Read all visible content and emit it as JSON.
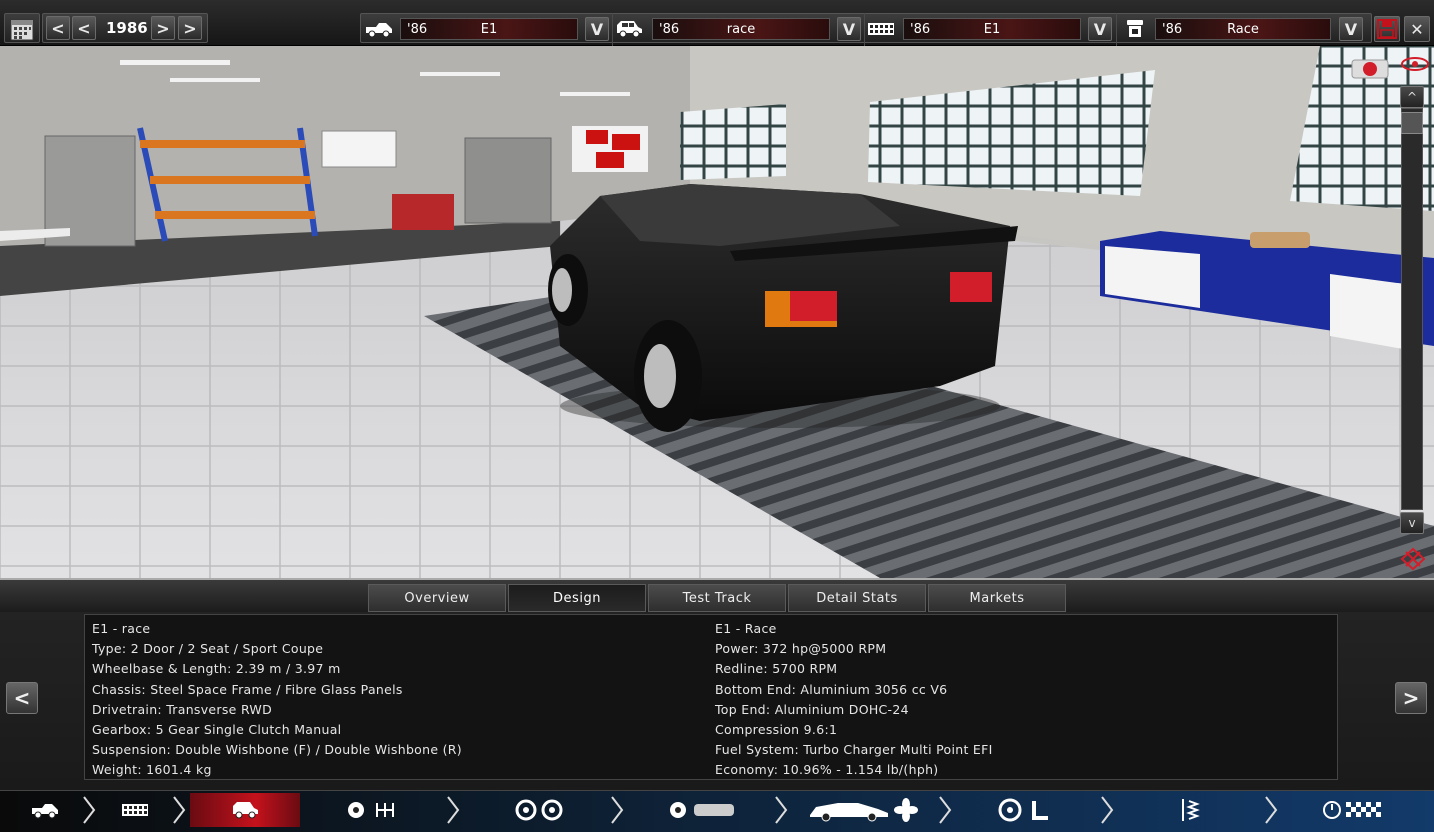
{
  "top_bar": {
    "year": "1986",
    "prev_labels": [
      "<",
      "<"
    ],
    "next_labels": [
      ">",
      ">"
    ],
    "selectors": [
      {
        "year": "'86",
        "name": "E1",
        "icon": "car-model-icon"
      },
      {
        "year": "'86",
        "name": "race",
        "icon": "car-trim-icon"
      },
      {
        "year": "'86",
        "name": "E1",
        "icon": "engine-icon"
      },
      {
        "year": "'86",
        "name": "Race",
        "icon": "engine-variant-icon"
      }
    ],
    "dropdown_label": "V",
    "close_label": "✕"
  },
  "side_controls": {
    "up": "^",
    "down": "v"
  },
  "tabs": [
    {
      "label": "Overview",
      "active": false
    },
    {
      "label": "Design",
      "active": true
    },
    {
      "label": "Test Track",
      "active": false
    },
    {
      "label": "Detail Stats",
      "active": false
    },
    {
      "label": "Markets",
      "active": false
    }
  ],
  "info_left": [
    "E1 - race",
    "Type: 2 Door / 2 Seat / Sport Coupe",
    "Wheelbase & Length: 2.39 m / 3.97 m",
    "Chassis: Steel Space Frame / Fibre Glass Panels",
    "Drivetrain: Transverse RWD",
    "Gearbox: 5 Gear Single Clutch Manual",
    "Suspension: Double Wishbone (F) / Double Wishbone (R)",
    "Weight: 1601.4 kg"
  ],
  "info_right": [
    "E1 - Race",
    "Power: 372 hp@5000 RPM",
    "Redline: 5700 RPM",
    "Bottom End: Aluminium 3056 cc V6",
    "Top End: Aluminium DOHC-24",
    "Compression 9.6:1",
    "Fuel System: Turbo Charger Multi Point EFI",
    "Economy: 10.96% - 1.154 lb/(hph)"
  ],
  "nav_arrows": {
    "left": "<",
    "right": ">"
  },
  "bottom_nav": [
    {
      "icon": "car-model-icon",
      "active": false
    },
    {
      "icon": "chassis-icon",
      "active": false
    },
    {
      "icon": "car-trim-icon",
      "active": true
    },
    {
      "icon": "gearbox-icon",
      "active": false
    },
    {
      "icon": "wheels-icon",
      "active": false
    },
    {
      "icon": "body-icon",
      "active": false
    },
    {
      "icon": "aero-icon",
      "active": false
    },
    {
      "icon": "interior-icon",
      "active": false
    },
    {
      "icon": "suspension-icon",
      "active": false
    },
    {
      "icon": "testing-icon",
      "active": false
    }
  ],
  "colors": {
    "accent_red": "#c4121c",
    "selector_red": "#4a1515",
    "nav_blue": "#123a6a"
  }
}
